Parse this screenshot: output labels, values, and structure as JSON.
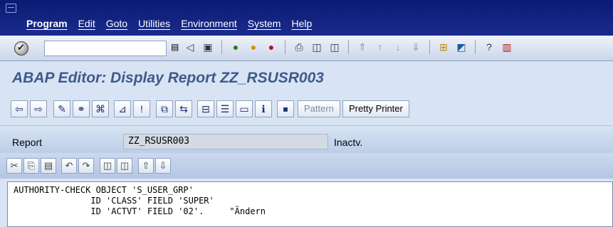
{
  "menubar": {
    "items": [
      "Program",
      "Edit",
      "Goto",
      "Utilities",
      "Environment",
      "System",
      "Help"
    ]
  },
  "system_toolbar": {
    "command_value": "",
    "icons": [
      "back-arrow-icon",
      "save-icon",
      "back-icon",
      "exit-icon",
      "cancel-icon",
      "print-icon",
      "find-icon",
      "find-next-icon",
      "first-page-icon",
      "previous-page-icon",
      "next-page-icon",
      "last-page-icon",
      "create-session-icon",
      "shortcut-icon",
      "help-icon",
      "customize-layout-icon"
    ]
  },
  "title": "ABAP Editor: Display Report ZZ_RSUSR003",
  "app_toolbar": {
    "pattern_label": "Pattern",
    "pretty_printer_label": "Pretty Printer"
  },
  "report": {
    "label": "Report",
    "value": "ZZ_RSUSR003",
    "status": "Inactv."
  },
  "editor": {
    "lines": [
      "AUTHORITY-CHECK OBJECT 'S_USER_GRP'",
      "               ID 'CLASS' FIELD 'SUPER'",
      "               ID 'ACTVT' FIELD '02'.     \"Ändern"
    ]
  },
  "colors": {
    "menubar": "#0b1a73",
    "title": "#3e5a8c",
    "background": "#d8e4f3"
  }
}
